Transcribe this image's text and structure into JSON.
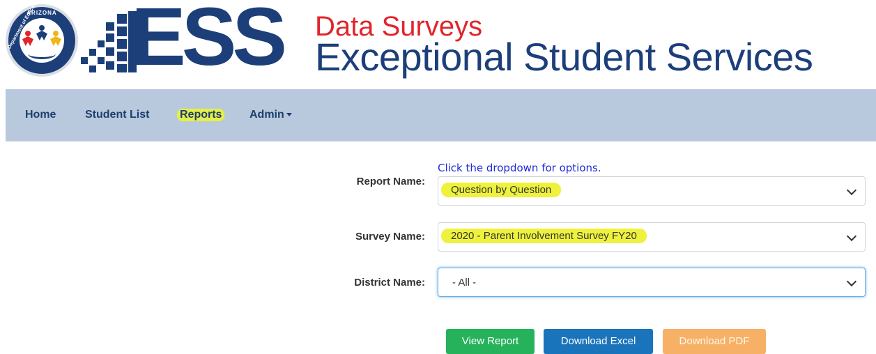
{
  "header": {
    "seal_top": "ARIZONA",
    "seal_side": "Department of Education",
    "logo_ess": "ESS",
    "subtitle_red": "Data Surveys",
    "subtitle_main": "Exceptional Student Services"
  },
  "nav": {
    "items": [
      {
        "label": "Home"
      },
      {
        "label": "Student List"
      },
      {
        "label": "Reports"
      },
      {
        "label": "Admin"
      }
    ]
  },
  "form": {
    "hint": "Click the dropdown for options.",
    "report_label": "Report Name:",
    "report_value": "Question by Question",
    "survey_label": "Survey Name:",
    "survey_value": "2020 - Parent Involvement Survey FY20",
    "district_label": "District Name:",
    "district_value": "- All -"
  },
  "buttons": {
    "view": "View Report",
    "excel": "Download Excel",
    "pdf": "Download PDF"
  },
  "colors": {
    "brand_blue": "#1c3f7a",
    "brand_red": "#e0252b",
    "nav_bg": "#b9c9dd",
    "highlight": "#e6f046"
  }
}
